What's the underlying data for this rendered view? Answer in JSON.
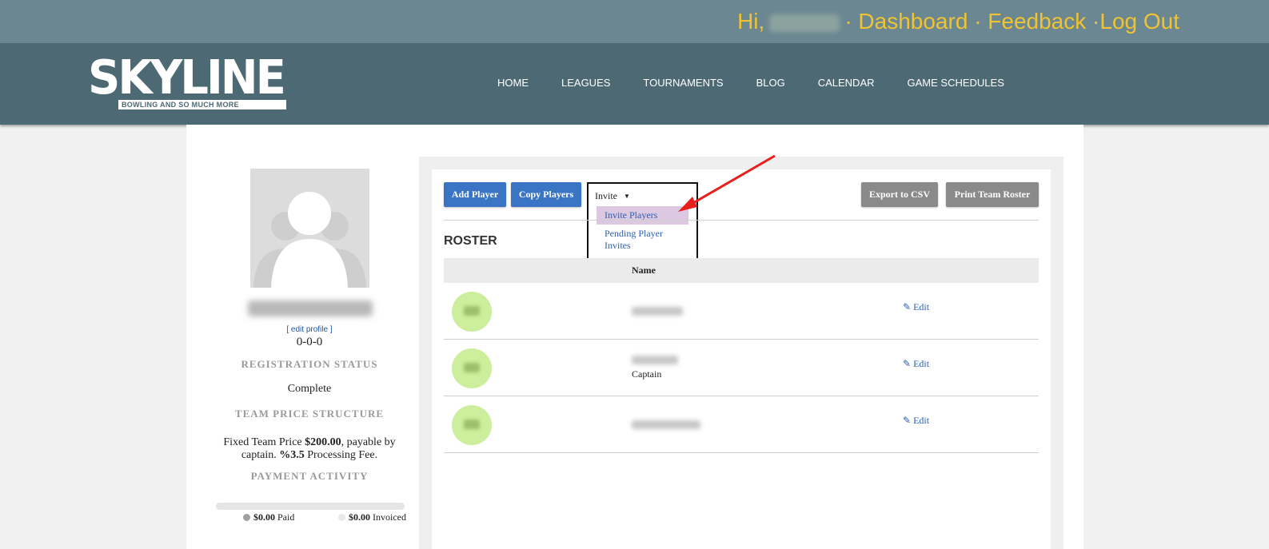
{
  "header": {
    "greeting": "Hi,",
    "links": [
      {
        "label": "· Dashboard "
      },
      {
        "label": "· Feedback "
      },
      {
        "label": "·Log Out"
      }
    ]
  },
  "logo": {
    "word": "SKYLINE",
    "tagline": "BOWLING AND SO MUCH MORE"
  },
  "nav": {
    "items": [
      "HOME",
      "LEAGUES",
      "TOURNAMENTS",
      "BLOG",
      "CALENDAR",
      "GAME SCHEDULES"
    ]
  },
  "sidebar": {
    "edit_profile": "[ edit profile ]",
    "record": "0-0-0",
    "registration_heading": "REGISTRATION STATUS",
    "registration_value": "Complete",
    "price_heading": "TEAM PRICE STRUCTURE",
    "price_prefix": "Fixed Team Price ",
    "price_amount": "$200.00",
    "price_mid": ", payable by captain. ",
    "fee_amount": "%3.5",
    "fee_suffix": " Processing Fee.",
    "payment_heading": "PAYMENT ACTIVITY",
    "paid_amount": "$0.00",
    "paid_label": " Paid",
    "invoiced_amount": "$0.00",
    "invoiced_label": " Invoiced",
    "paid_fraction": 0
  },
  "toolbar": {
    "add_player": "Add Player",
    "copy_players": "Copy Players",
    "invite": "Invite",
    "caret": "▼",
    "invite_menu": [
      "Invite Players",
      "Pending Player Invites"
    ],
    "export_csv": "Export to CSV",
    "print_roster": "Print Team Roster"
  },
  "roster": {
    "title": "ROSTER",
    "column_name": "Name",
    "rows": [
      {
        "role": "",
        "edit": "Edit"
      },
      {
        "role": "Captain",
        "edit": "Edit"
      },
      {
        "role": "",
        "edit": "Edit"
      }
    ]
  },
  "colors": {
    "topbar": "#6b8791",
    "navbar": "#4d6a74",
    "link_yellow": "#f0c330",
    "button_blue": "#3a74c4",
    "button_gray": "#8a8a8a",
    "avatar_green": "#cdee9c",
    "menu_highlight": "#dcc8e0",
    "annotation_arrow": "#e8201b"
  }
}
